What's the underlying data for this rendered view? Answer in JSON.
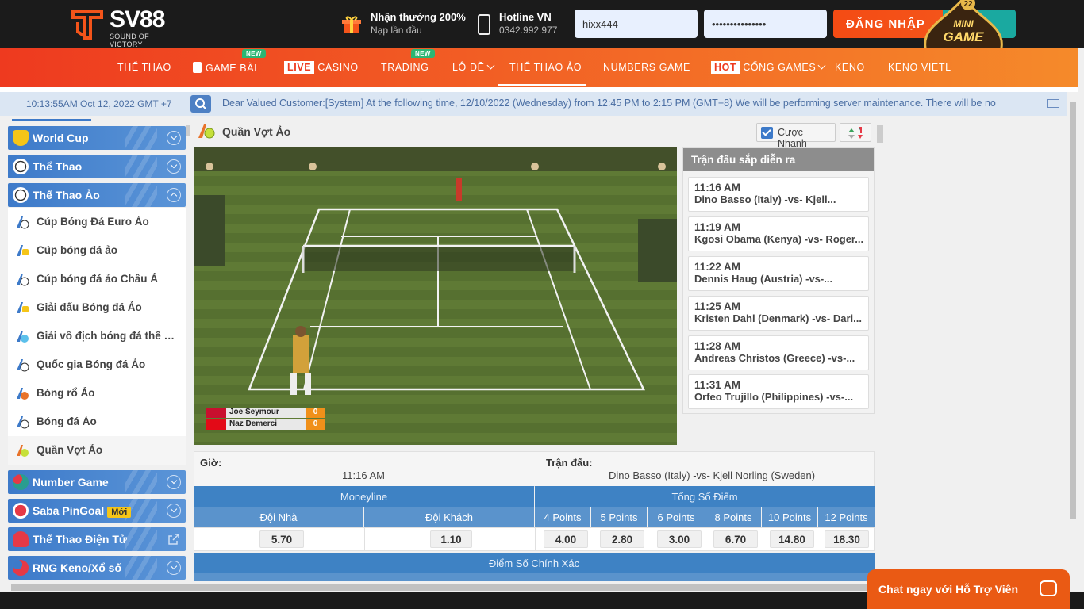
{
  "header": {
    "brand": "SV88",
    "tagline": "SOUND OF VICTORY",
    "promo_title": "Nhận thưởng 200%",
    "promo_sub": "Nạp lần đầu",
    "hotline_title": "Hotline VN",
    "hotline_number": "0342.992.977",
    "username_value": "hixx444",
    "password_value": "•••••••••••••••",
    "login_label": "ĐĂNG NHẬP",
    "minigame_label": "MINI GAME",
    "minigame_number": "22"
  },
  "nav": {
    "items": [
      {
        "label": "THỂ THAO"
      },
      {
        "label": "GAME BÀI",
        "badge": "NEW"
      },
      {
        "label": "CASINO",
        "live": "LIVE"
      },
      {
        "label": "TRADING",
        "badge": "NEW"
      },
      {
        "label": "LÔ ĐỀ"
      },
      {
        "label": "THỂ THAO ẢO"
      },
      {
        "label": "NUMBERS GAME"
      },
      {
        "label": "CỔNG GAMES",
        "hot": "HOT"
      },
      {
        "label": "KENO"
      },
      {
        "label": "KENO VIETL"
      }
    ]
  },
  "ticker": {
    "time": "10:13:55AM Oct 12, 2022 GMT +7",
    "message": "Dear Valued Customer:[System] At the following time, 12/10/2022 (Wednesday) from 12:45 PM to 2:15 PM (GMT+8) We will be performing server maintenance. There will be no"
  },
  "sidebar": {
    "groups_top": [
      {
        "label": "World Cup"
      },
      {
        "label": "Thể Thao"
      },
      {
        "label": "Thể Thao Ảo"
      }
    ],
    "items": [
      {
        "label": "Cúp Bóng Đá Euro Ảo"
      },
      {
        "label": "Cúp bóng đá ảo"
      },
      {
        "label": "Cúp bóng đá ảo Châu Á"
      },
      {
        "label": "Giải đấu Bóng đá Ảo"
      },
      {
        "label": "Giải vô địch bóng đá thế giới ảo"
      },
      {
        "label": "Quốc gia Bóng đá Ảo"
      },
      {
        "label": "Bóng rổ Ảo"
      },
      {
        "label": "Bóng đá Ảo"
      },
      {
        "label": "Quần Vợt Ảo"
      }
    ],
    "groups_bottom": [
      {
        "label": "Number Game"
      },
      {
        "label": "Saba PinGoal",
        "badge": "Mới"
      },
      {
        "label": "Thể Thao Điện Tử"
      },
      {
        "label": "RNG Keno/Xổ số"
      }
    ]
  },
  "main": {
    "title": "Quần Vợt Ảo",
    "quick_bet_label": "Cược Nhanh",
    "scoreboard": [
      {
        "player": "Joe Seymour",
        "score": "0"
      },
      {
        "player": "Naz Demerci",
        "score": "0"
      }
    ]
  },
  "upcoming": {
    "title": "Trận đấu sắp diễn ra",
    "matches": [
      {
        "time": "11:16 AM",
        "match": "Dino Basso (Italy) -vs- Kjell..."
      },
      {
        "time": "11:19 AM",
        "match": "Kgosi Obama (Kenya) -vs- Roger..."
      },
      {
        "time": "11:22 AM",
        "match": "Dennis Haug (Austria) -vs-..."
      },
      {
        "time": "11:25 AM",
        "match": "Kristen Dahl (Denmark) -vs- Dari..."
      },
      {
        "time": "11:28 AM",
        "match": "Andreas Christos (Greece) -vs-..."
      },
      {
        "time": "11:31 AM",
        "match": "Orfeo Trujillo (Philippines) -vs-..."
      }
    ]
  },
  "match_info": {
    "time_label": "Giờ:",
    "time_value": "11:16 AM",
    "match_label": "Trận đấu:",
    "match_value": "Dino Basso (Italy) -vs- Kjell Norling (Sweden)"
  },
  "betting": {
    "moneyline_label": "Moneyline",
    "total_label": "Tổng Số Điểm",
    "home_label": "Đội Nhà",
    "away_label": "Đội Khách",
    "home_odds": "5.70",
    "away_odds": "1.10",
    "totals": [
      {
        "label": "4 Points",
        "odds": "4.00"
      },
      {
        "label": "5 Points",
        "odds": "2.80"
      },
      {
        "label": "6 Points",
        "odds": "3.00"
      },
      {
        "label": "8 Points",
        "odds": "6.70"
      },
      {
        "label": "10 Points",
        "odds": "14.80"
      },
      {
        "label": "12 Points",
        "odds": "18.30"
      }
    ],
    "exact_score_label": "Điểm Số Chính Xác"
  },
  "chat": {
    "label": "Chat ngay với Hỗ Trợ Viên"
  },
  "colors": {
    "accent": "#ee3a1f",
    "brand_blue": "#3e82c4",
    "login": "#f44b14"
  }
}
